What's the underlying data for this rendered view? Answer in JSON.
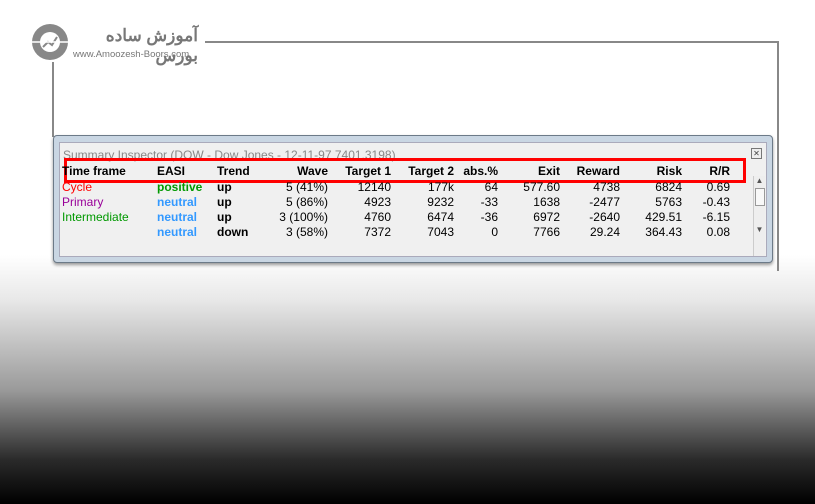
{
  "logo": {
    "text_fa": "آموزش ساده بورس",
    "text_en": "www.Amoozesh-Boors.com"
  },
  "window": {
    "title": "Summary Inspector (DOW - Dow Jones - 12-11-97  7401.3198)",
    "close_icon": "close-icon"
  },
  "columns": [
    "Time frame",
    "EASI",
    "Trend",
    "Wave",
    "Target 1",
    "Target 2",
    "abs.%",
    "Exit",
    "Reward",
    "Risk",
    "R/R"
  ],
  "rows": [
    {
      "timeframe": "Cycle",
      "tf_color": "#ff0000",
      "easi": "positive",
      "easi_color": "#009900",
      "trend": "up",
      "wave": "5 (41%)",
      "t1": "12140",
      "t2": "177k",
      "abs": "64",
      "exit": "577.60",
      "reward": "4738",
      "risk": "6824",
      "rr": "0.69"
    },
    {
      "timeframe": "Primary",
      "tf_color": "#990099",
      "easi": "neutral",
      "easi_color": "#3399ff",
      "trend": "up",
      "wave": "5 (86%)",
      "t1": "4923",
      "t2": "9232",
      "abs": "-33",
      "exit": "1638",
      "reward": "-2477",
      "risk": "5763",
      "rr": "-0.43"
    },
    {
      "timeframe": "Intermediate",
      "tf_color": "#009900",
      "easi": "neutral",
      "easi_color": "#3399ff",
      "trend": "up",
      "wave": "3 (100%)",
      "t1": "4760",
      "t2": "6474",
      "abs": "-36",
      "exit": "6972",
      "reward": "-2640",
      "risk": "429.51",
      "rr": "-6.15"
    },
    {
      "timeframe": "",
      "tf_color": "#000000",
      "easi": "neutral",
      "easi_color": "#3399ff",
      "trend": "down",
      "wave": "3 (58%)",
      "t1": "7372",
      "t2": "7043",
      "abs": "0",
      "exit": "7766",
      "reward": "29.24",
      "risk": "364.43",
      "rr": "0.08"
    }
  ],
  "highlight_color": "#ff0000"
}
